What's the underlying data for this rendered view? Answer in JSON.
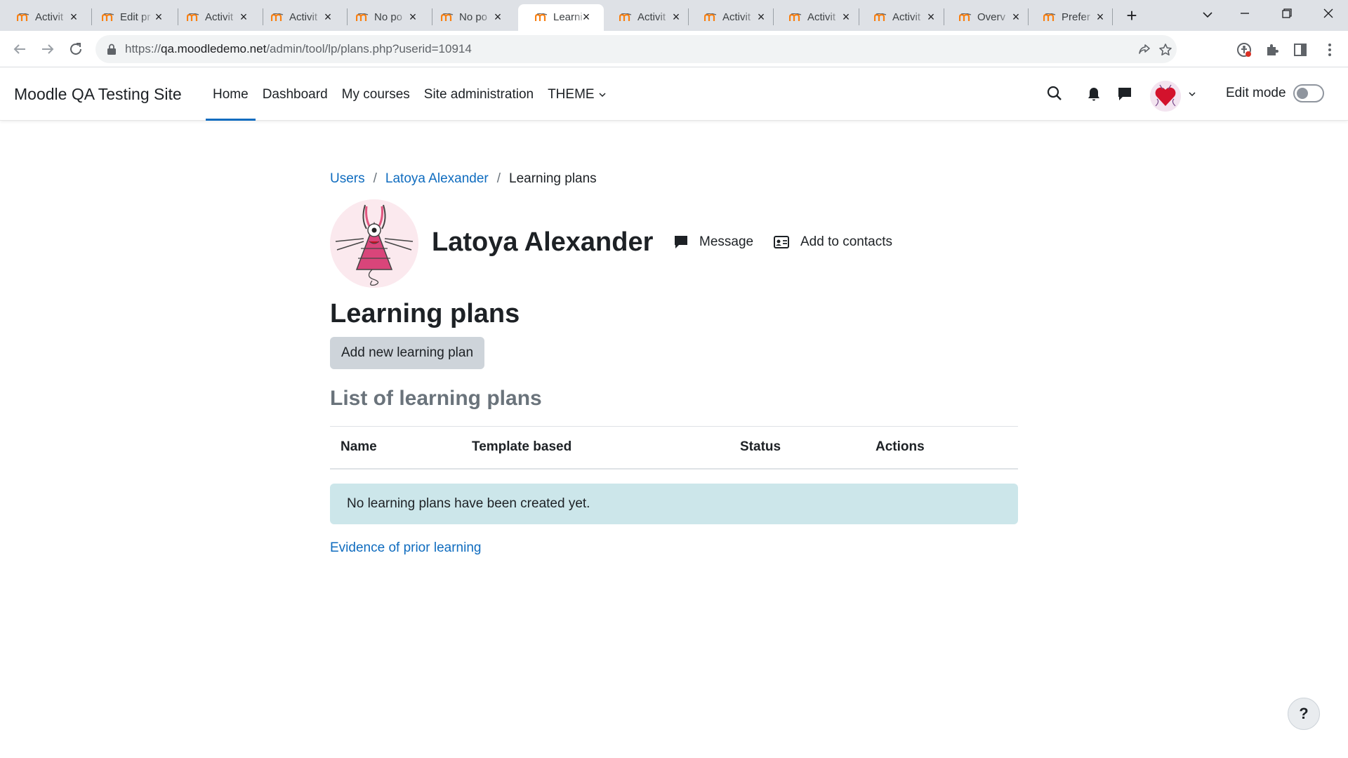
{
  "browser": {
    "tabs": [
      {
        "title": "Activit",
        "active": false
      },
      {
        "title": "Edit pr",
        "active": false
      },
      {
        "title": "Activit",
        "active": false
      },
      {
        "title": "Activit",
        "active": false
      },
      {
        "title": "No po",
        "active": false
      },
      {
        "title": "No po",
        "active": false
      },
      {
        "title": "Learni",
        "active": true
      },
      {
        "title": "Activit",
        "active": false
      },
      {
        "title": "Activit",
        "active": false
      },
      {
        "title": "Activit",
        "active": false
      },
      {
        "title": "Activit",
        "active": false
      },
      {
        "title": "Overv",
        "active": false
      },
      {
        "title": "Prefer",
        "active": false
      }
    ],
    "url_scheme": "https://",
    "url_host": "qa.moodledemo.net",
    "url_path": "/admin/tool/lp/plans.php?userid=10914"
  },
  "navbar": {
    "site_name": "Moodle QA Testing Site",
    "items": [
      {
        "label": "Home",
        "active": true
      },
      {
        "label": "Dashboard",
        "active": false
      },
      {
        "label": "My courses",
        "active": false
      },
      {
        "label": "Site administration",
        "active": false
      },
      {
        "label": "THEME",
        "active": false
      }
    ],
    "edit_mode_label": "Edit mode"
  },
  "breadcrumb": {
    "items": [
      {
        "label": "Users"
      },
      {
        "label": "Latoya Alexander"
      },
      {
        "label": "Learning plans"
      }
    ]
  },
  "user": {
    "full_name": "Latoya Alexander",
    "message_label": "Message",
    "add_contact_label": "Add to contacts"
  },
  "page": {
    "heading": "Learning plans",
    "add_button_label": "Add new learning plan",
    "list_heading": "List of learning plans",
    "table_headers": [
      "Name",
      "Template based",
      "Status",
      "Actions"
    ],
    "empty_message": "No learning plans have been created yet.",
    "evidence_link": "Evidence of prior learning"
  },
  "help": {
    "label": "?"
  },
  "colors": {
    "link": "#0f6cbf",
    "alert_bg": "#cce6ea",
    "button_bg": "#ced4da",
    "favicon": "#f98012"
  }
}
